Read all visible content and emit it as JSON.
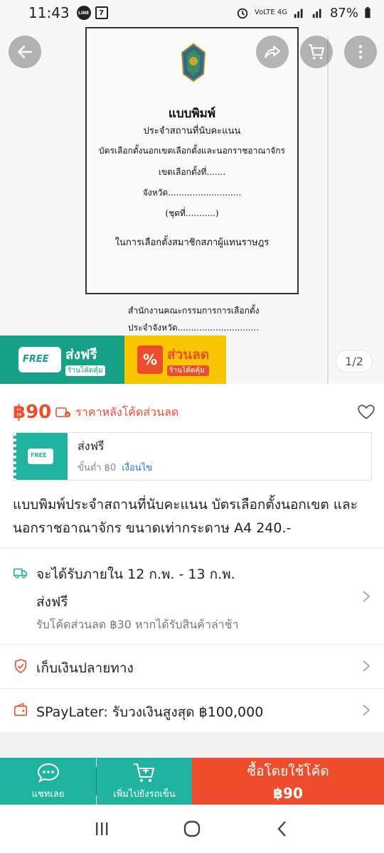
{
  "status_bar": {
    "time": "11:43",
    "line_icon": "line-app-icon",
    "seven_icon": "7-eleven-icon",
    "network": "VoLTE 4G",
    "battery": "87%"
  },
  "document_preview": {
    "title": "แบบพิมพ์",
    "line1": "ประจำสถานที่นับคะแนน",
    "line2": "บัตรเลือกตั้งนอกเขตเลือกตั้งและนอกราชอาณาจักร",
    "line3": "เขตเลือกตั้งที่.......",
    "line4": "จังหวัด...........................",
    "line5": "(ชุดที่...........)",
    "line6": "ในการเลือกตั้งสมาชิกสภาผู้แทนราษฎร",
    "footer1": "สำนักงานคณะกรรมการการเลือกตั้ง",
    "footer2": "ประจำจังหวัด.............................."
  },
  "promo": {
    "free_badge": "FREE",
    "free_title": "ส่งฟรี",
    "free_sub": "ร้านโค้ดคุ้ม",
    "sale_title": "ส่วนลด",
    "sale_sub": "ร้านโค้ดคุ้ม",
    "sale_symbol": "%"
  },
  "pager": "1/2",
  "price": {
    "amount": "฿90",
    "note": "ราคาหลังโค้ดส่วนลด"
  },
  "shipping_card": {
    "badge": "FREE",
    "title": "ส่งฟรี",
    "sub": "ขั้นต่ำ ฿0",
    "link": "เงื่อนไข"
  },
  "description": "แบบพิมพ์ประจำสถานที่นับคะแนน บัตรเลือกตั้งนอกเขต และนอกราชอาณาจักร  ขนาดเท่ากระดาษ A4 240.-",
  "delivery": {
    "eta": "จะได้รับภายใน 12 ก.พ. - 13 ก.พ.",
    "ship": "ส่งฟรี",
    "late": "รับโค้ดส่วนลด ฿30 หากได้รับสินค้าล่าช้า"
  },
  "cod": "เก็บเงินปลายทาง",
  "paylater": "SPayLater: รับวงเงินสูงสุด ฿100,000",
  "action_bar": {
    "chat": "แชทเลย",
    "cart": "เพิ่มไปยังรถเข็น",
    "buy": "ซื้อโดยใช้โค้ด",
    "buy_price": "฿90"
  },
  "colors": {
    "shopee_orange": "#ee4d2d",
    "teal": "#20b4a0",
    "link_blue": "#2673dd"
  }
}
